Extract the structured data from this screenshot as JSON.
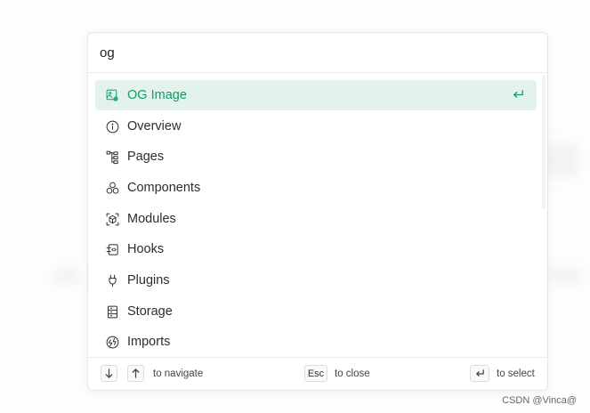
{
  "search": {
    "value": "og"
  },
  "results": [
    {
      "label": "OG Image",
      "icon": "og-image-icon",
      "active": true
    },
    {
      "label": "Overview",
      "icon": "info-icon",
      "active": false
    },
    {
      "label": "Pages",
      "icon": "pages-tree-icon",
      "active": false
    },
    {
      "label": "Components",
      "icon": "components-icon",
      "active": false
    },
    {
      "label": "Modules",
      "icon": "modules-cube-icon",
      "active": false
    },
    {
      "label": "Hooks",
      "icon": "hooks-icon",
      "active": false
    },
    {
      "label": "Plugins",
      "icon": "plug-icon",
      "active": false
    },
    {
      "label": "Storage",
      "icon": "storage-icon",
      "active": false
    },
    {
      "label": "Imports",
      "icon": "imports-icon",
      "active": false
    }
  ],
  "footer": {
    "navigate_label": "to navigate",
    "esc_key": "Esc",
    "close_label": "to close",
    "select_label": "to select"
  },
  "watermark": "CSDN @Vinca@",
  "colors": {
    "accent": "#0f9d68",
    "active_bg": "#e3f3ec"
  }
}
